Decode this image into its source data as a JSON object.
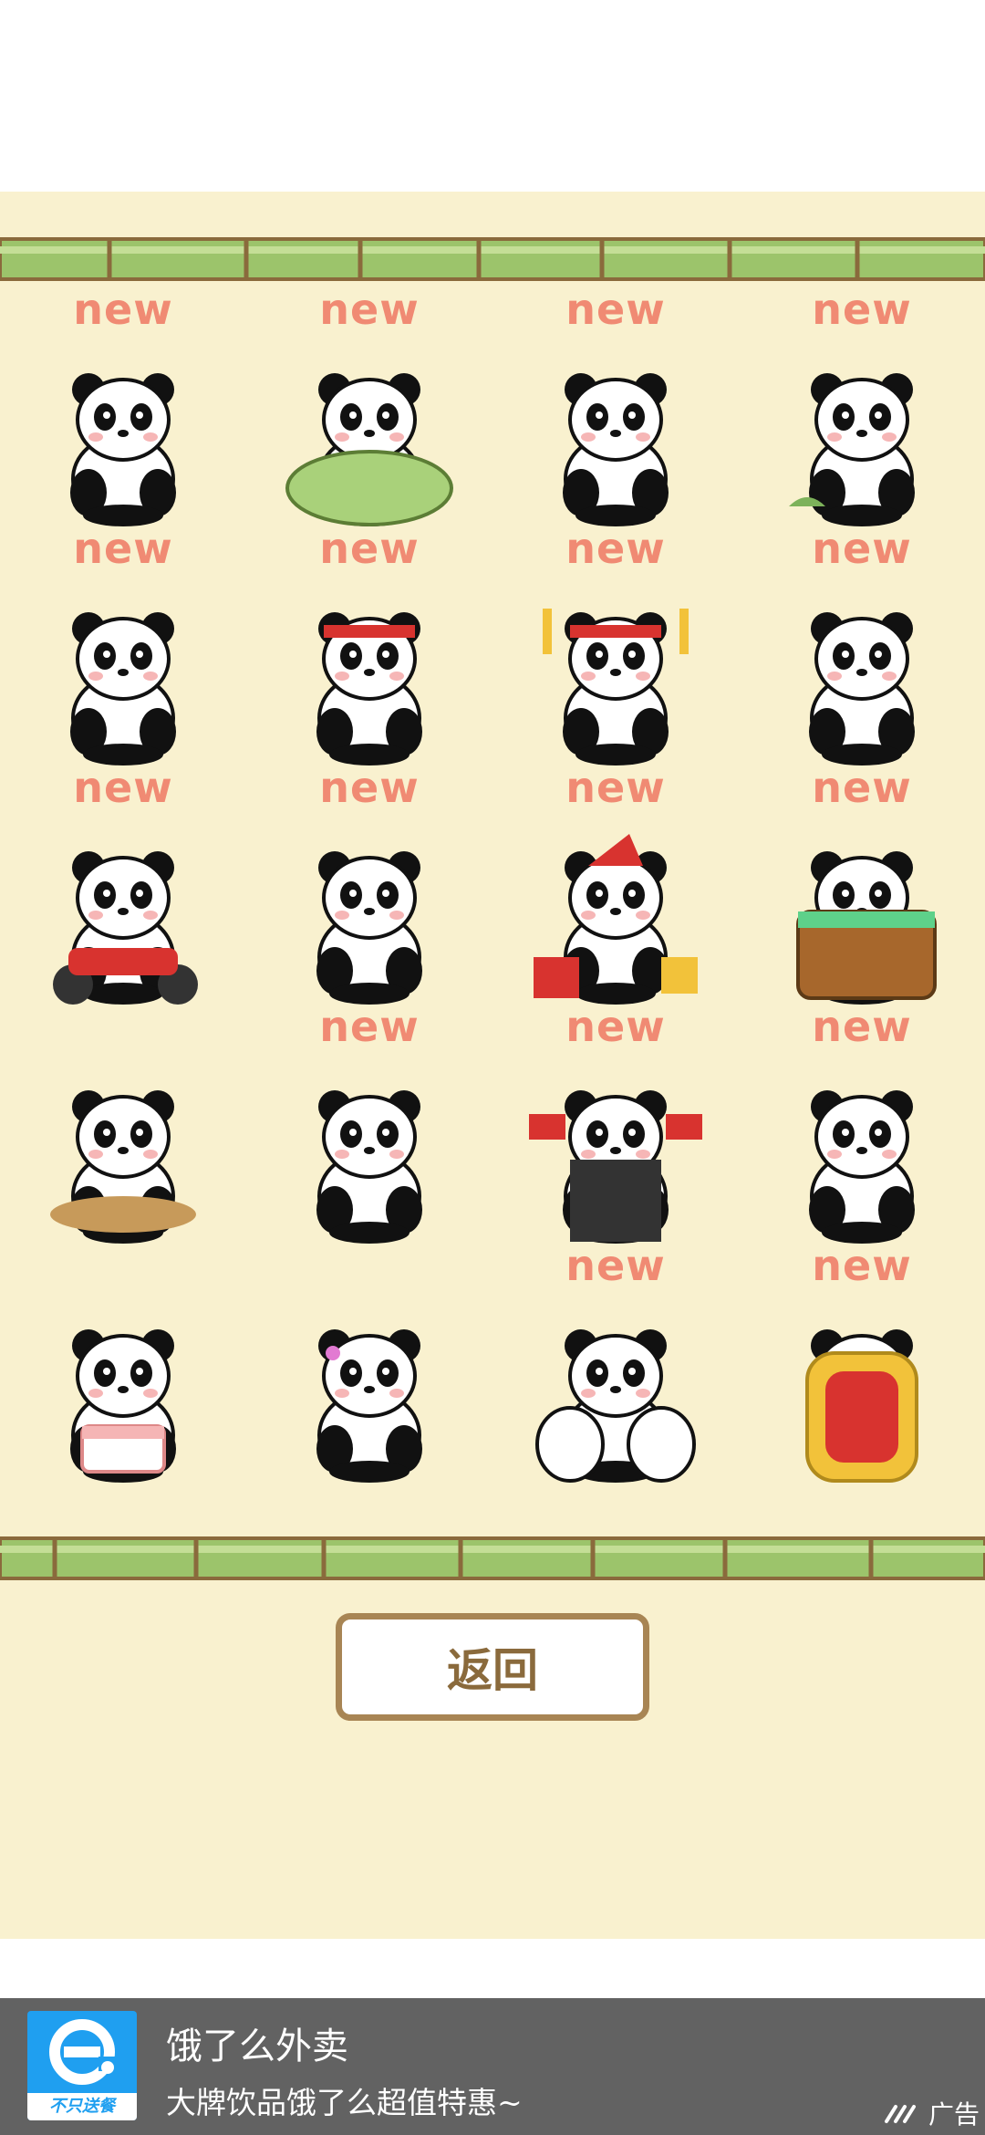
{
  "grid": {
    "cells": [
      {
        "new_label": "new",
        "sticker": "crying-panda"
      },
      {
        "new_label": "new",
        "sticker": "sleeping-panda-blanket"
      },
      {
        "new_label": "new",
        "sticker": "waving-panda"
      },
      {
        "new_label": "new",
        "sticker": "lying-panda-leaf"
      },
      {
        "new_label": "new",
        "sticker": "standing-panda"
      },
      {
        "new_label": "new",
        "sticker": "headband-panda"
      },
      {
        "new_label": "new",
        "sticker": "cheering-panda"
      },
      {
        "new_label": "new",
        "sticker": "leaning-panda"
      },
      {
        "new_label": "new",
        "sticker": "motorbike-panda"
      },
      {
        "new_label": "new",
        "sticker": "nervous-panda"
      },
      {
        "new_label": "new",
        "sticker": "gift-panda"
      },
      {
        "new_label": "new",
        "sticker": "bath-barrel-panda"
      },
      {
        "new_label": "",
        "sticker": "tea-table-pandas"
      },
      {
        "new_label": "new",
        "sticker": "shy-panda"
      },
      {
        "new_label": "new",
        "sticker": "coat-panda-flags"
      },
      {
        "new_label": "new",
        "sticker": "pointing-panda"
      },
      {
        "new_label": "",
        "sticker": "birthday-cake-pandas"
      },
      {
        "new_label": "",
        "sticker": "hugging-pandas"
      },
      {
        "new_label": "new",
        "sticker": "panda-pile"
      },
      {
        "new_label": "new",
        "sticker": "throne-panda"
      }
    ]
  },
  "back_button": {
    "label": "返回"
  },
  "ad": {
    "logo_text": "不只送餐",
    "title": "饿了么外卖",
    "description": "大牌饮品饿了么超值特惠~",
    "tag": "广告"
  },
  "colors": {
    "background": "#f9f1cf",
    "new_label": "#f08a73",
    "bamboo_green": "#9cc46b",
    "bamboo_outline": "#8a6a3c",
    "button_border": "#a88554",
    "ad_bg": "#626262",
    "ad_logo": "#1f9ff0"
  }
}
